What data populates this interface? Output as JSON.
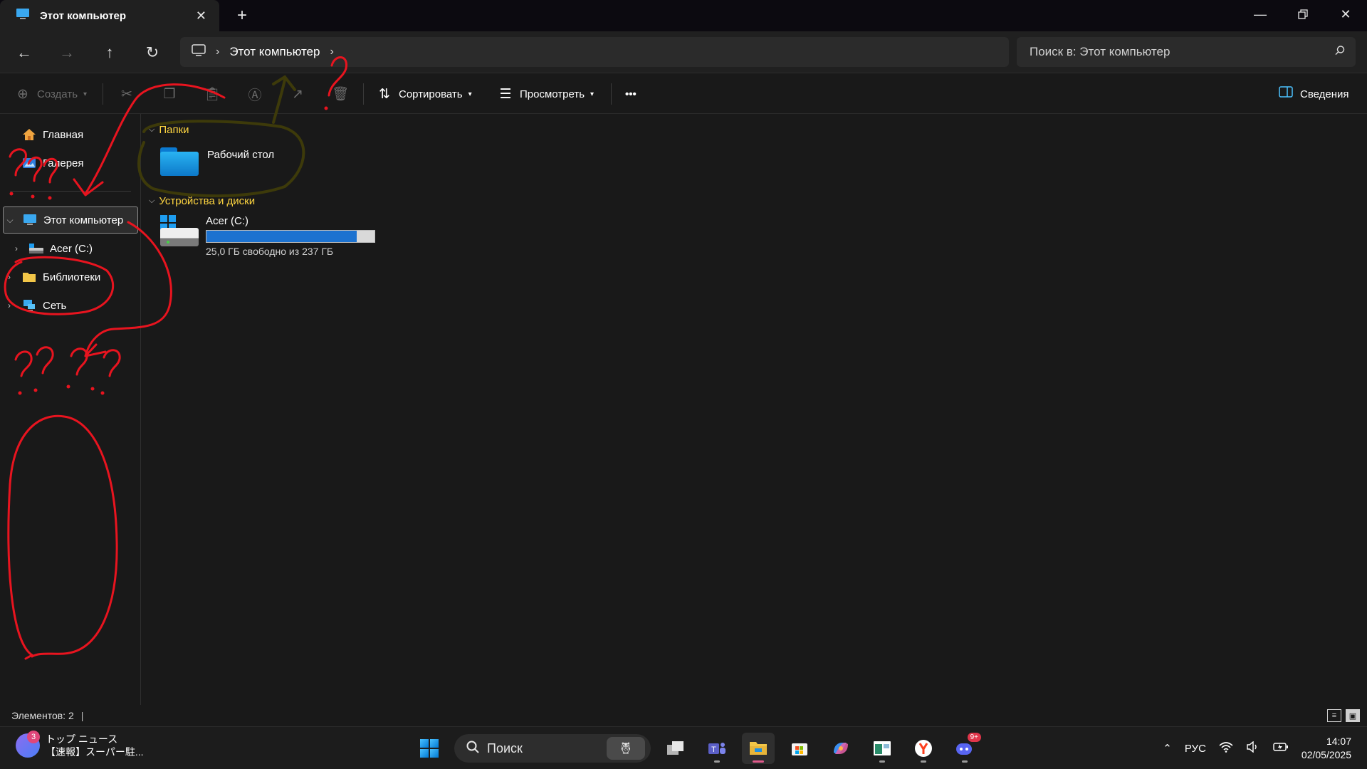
{
  "window": {
    "tab_title": "Этот компьютер",
    "close_tab": "✕",
    "new_tab": "+"
  },
  "address": {
    "crumb": "Этот компьютер",
    "search_placeholder": "Поиск в: Этот компьютер"
  },
  "toolbar": {
    "create": "Создать",
    "sort": "Сортировать",
    "view": "Просмотреть",
    "more": "•••",
    "details": "Сведения"
  },
  "sidebar": {
    "items": [
      {
        "label": "Главная"
      },
      {
        "label": "Галерея"
      },
      {
        "label": "Этот компьютер"
      },
      {
        "label": "Acer (C:)"
      },
      {
        "label": "Библиотеки"
      },
      {
        "label": "Сеть"
      }
    ]
  },
  "content": {
    "folders_header": "Папки",
    "folders": [
      {
        "name": "Рабочий стол"
      }
    ],
    "drives_header": "Устройства и диски",
    "drives": [
      {
        "name": "Acer (C:)",
        "free_text": "25,0 ГБ свободно из 237 ГБ",
        "used_fraction": 0.895
      }
    ]
  },
  "status": {
    "items_count": "Элементов: 2"
  },
  "taskbar": {
    "news_badge": "3",
    "news_title": "トップ ニュース",
    "news_subtitle": "【速報】スーパー駐...",
    "search_label": "Поиск",
    "lang": "РУС",
    "time": "14:07",
    "date": "02/05/2025",
    "discord_badge": "9+"
  },
  "colors": {
    "accent_yellow": "#ffd640",
    "drive_bar": "#1c72d0",
    "annotation_red": "#e8141f",
    "annotation_olive": "#3d3a0a"
  }
}
